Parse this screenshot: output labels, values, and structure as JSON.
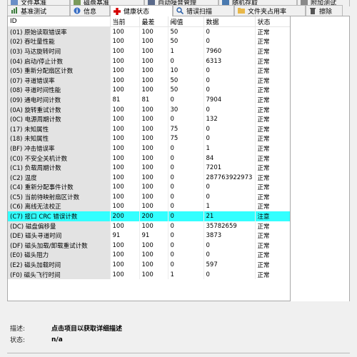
{
  "tabs_top": [
    {
      "label": "文件基准"
    },
    {
      "label": "磁盘基准"
    },
    {
      "label": "自动噪音管理"
    },
    {
      "label": "随机存取"
    },
    {
      "label": "附加测试"
    }
  ],
  "tabs": [
    {
      "label": "基准测试"
    },
    {
      "label": "信息"
    },
    {
      "label": "健康状态"
    },
    {
      "label": "错误扫描"
    },
    {
      "label": "文件夹占用率"
    },
    {
      "label": "擦除"
    }
  ],
  "table": {
    "headers": [
      "ID",
      "当前",
      "最差",
      "阈值",
      "数据",
      "状态"
    ],
    "rows": [
      [
        "(01) 原始读取错误率",
        "100",
        "100",
        "50",
        "0",
        "正常"
      ],
      [
        "(02) 吞吐量性能",
        "100",
        "100",
        "50",
        "0",
        "正常"
      ],
      [
        "(03) 马达旋转时间",
        "100",
        "100",
        "1",
        "7960",
        "正常"
      ],
      [
        "(04) 启动/停止计数",
        "100",
        "100",
        "0",
        "6313",
        "正常"
      ],
      [
        "(05) 重新分配扇区计数",
        "100",
        "100",
        "10",
        "0",
        "正常"
      ],
      [
        "(07) 寻道错误率",
        "100",
        "100",
        "50",
        "0",
        "正常"
      ],
      [
        "(08) 寻道时间性能",
        "100",
        "100",
        "50",
        "0",
        "正常"
      ],
      [
        "(09) 通电时间计数",
        "81",
        "81",
        "0",
        "7904",
        "正常"
      ],
      [
        "(0A) 旋转重试计数",
        "100",
        "100",
        "30",
        "0",
        "正常"
      ],
      [
        "(0C) 电源周期计数",
        "100",
        "100",
        "0",
        "132",
        "正常"
      ],
      [
        "(17) 未知属性",
        "100",
        "100",
        "75",
        "0",
        "正常"
      ],
      [
        "(18) 未知属性",
        "100",
        "100",
        "75",
        "0",
        "正常"
      ],
      [
        "(BF) 冲击错误率",
        "100",
        "100",
        "0",
        "1",
        "正常"
      ],
      [
        "(C0) 不安全关机计数",
        "100",
        "100",
        "0",
        "84",
        "正常"
      ],
      [
        "(C1) 负载周期计数",
        "100",
        "100",
        "0",
        "7201",
        "正常"
      ],
      [
        "(C2) 温度",
        "100",
        "100",
        "0",
        "287763922973",
        "正常"
      ],
      [
        "(C4) 重新分配事件计数",
        "100",
        "100",
        "0",
        "0",
        "正常"
      ],
      [
        "(C5) 当前待映射扇区计数",
        "100",
        "100",
        "0",
        "0",
        "正常"
      ],
      [
        "(C6) 离线无法校正",
        "100",
        "100",
        "0",
        "1",
        "正常"
      ],
      [
        "(C7) 接口 CRC 错误计数",
        "200",
        "200",
        "0",
        "21",
        "注意"
      ],
      [
        "(DC) 磁盘偏移量",
        "100",
        "100",
        "0",
        "35782659",
        "正常"
      ],
      [
        "(DE) 磁头寻道时间",
        "91",
        "91",
        "0",
        "3873",
        "正常"
      ],
      [
        "(DF) 磁头加载/卸载重试计数",
        "100",
        "100",
        "0",
        "0",
        "正常"
      ],
      [
        "(E0) 磁头阻力",
        "100",
        "100",
        "0",
        "0",
        "正常"
      ],
      [
        "(E2) 磁头加载时间",
        "100",
        "100",
        "0",
        "597",
        "正常"
      ],
      [
        "(F0) 磁头飞行时间",
        "100",
        "100",
        "1",
        "0",
        "正常"
      ]
    ]
  },
  "details": {
    "desc_label": "描述:",
    "desc_value": "点击项目以获取详细描述",
    "status_label": "状态:",
    "status_value": "n/a"
  },
  "colors": {
    "selected_row": "#33ffff",
    "active_tab_icon": "#d40000"
  }
}
